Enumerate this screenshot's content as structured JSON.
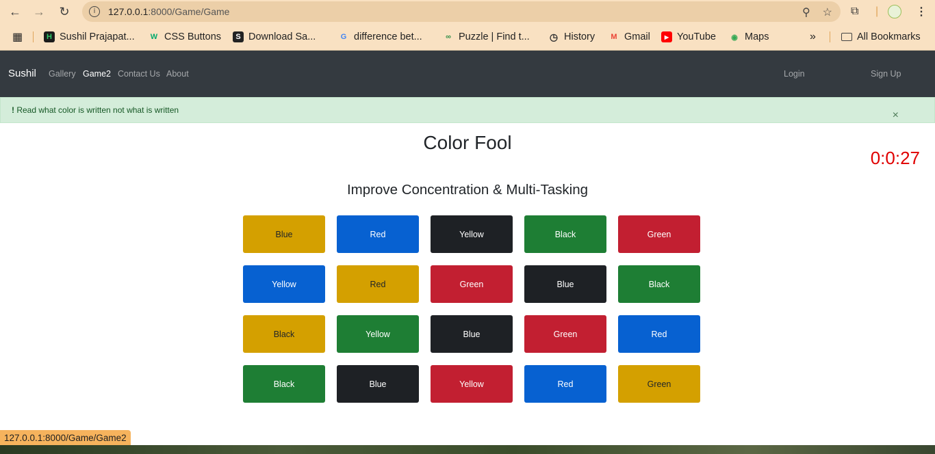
{
  "browser": {
    "url_host": "127.0.0.1",
    "url_rest": ":8000/Game/Game",
    "bookmarks": [
      {
        "label": "Sushil Prajapat...",
        "icon": "hackerrank-icon"
      },
      {
        "label": "CSS Buttons",
        "icon": "w3-icon"
      },
      {
        "label": "Download Sa...",
        "icon": "s-logo-icon"
      },
      {
        "label": "difference bet...",
        "icon": "google-icon"
      },
      {
        "label": "Puzzle | Find t...",
        "icon": "gfg-icon"
      },
      {
        "label": "History",
        "icon": "history-icon"
      },
      {
        "label": "Gmail",
        "icon": "gmail-icon"
      },
      {
        "label": "YouTube",
        "icon": "youtube-icon"
      },
      {
        "label": "Maps",
        "icon": "maps-icon"
      }
    ],
    "all_bookmarks": "All Bookmarks",
    "status_url": "127.0.0.1:8000/Game/Game2"
  },
  "navbar": {
    "brand": "Sushil",
    "links": [
      {
        "label": "Gallery",
        "active": false
      },
      {
        "label": "Game2",
        "active": true
      },
      {
        "label": "Contact Us",
        "active": false
      },
      {
        "label": "About",
        "active": false
      }
    ],
    "login": "Login",
    "signup": "Sign Up"
  },
  "alert": {
    "strong": "!",
    "message": " Read what color is written not what is written",
    "close": "×"
  },
  "game": {
    "title": "Color Fool",
    "timer": "0:0:27",
    "subtitle": "Improve Concentration & Multi-Tasking",
    "colors": {
      "yellow": "#d4a000",
      "blue": "#0761d1",
      "dark": "#1e2125",
      "green": "#1e7e34",
      "red": "#c21f31"
    },
    "tiles": [
      {
        "label": "Blue",
        "color": "yellow"
      },
      {
        "label": "Red",
        "color": "blue"
      },
      {
        "label": "Yellow",
        "color": "dark"
      },
      {
        "label": "Black",
        "color": "green"
      },
      {
        "label": "Green",
        "color": "red"
      },
      {
        "label": "Yellow",
        "color": "blue"
      },
      {
        "label": "Red",
        "color": "yellow"
      },
      {
        "label": "Green",
        "color": "red"
      },
      {
        "label": "Blue",
        "color": "dark"
      },
      {
        "label": "Black",
        "color": "green"
      },
      {
        "label": "Black",
        "color": "yellow"
      },
      {
        "label": "Yellow",
        "color": "green"
      },
      {
        "label": "Blue",
        "color": "dark"
      },
      {
        "label": "Green",
        "color": "red"
      },
      {
        "label": "Red",
        "color": "blue"
      },
      {
        "label": "Black",
        "color": "green"
      },
      {
        "label": "Blue",
        "color": "dark"
      },
      {
        "label": "Yellow",
        "color": "red"
      },
      {
        "label": "Red",
        "color": "blue"
      },
      {
        "label": "Green",
        "color": "yellow"
      }
    ]
  }
}
